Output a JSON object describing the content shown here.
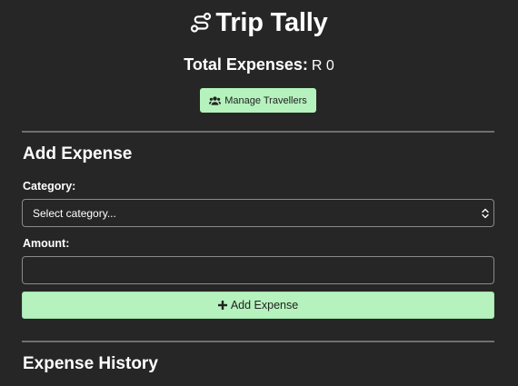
{
  "app": {
    "title": "Trip Tally",
    "icon": "route-icon"
  },
  "summary": {
    "total_label": "Total Expenses:",
    "total_value": "R 0"
  },
  "manage_travellers": {
    "label": "Manage Travellers",
    "icon": "users-icon"
  },
  "add_expense": {
    "title": "Add Expense",
    "category_label": "Category:",
    "category_selected": "Select category...",
    "amount_label": "Amount:",
    "amount_value": "",
    "submit_label": "Add Expense",
    "submit_icon": "plus-icon"
  },
  "history": {
    "title": "Expense History"
  },
  "colors": {
    "background": "#262626",
    "accent": "#b5f2bd",
    "text": "#ffffff"
  }
}
